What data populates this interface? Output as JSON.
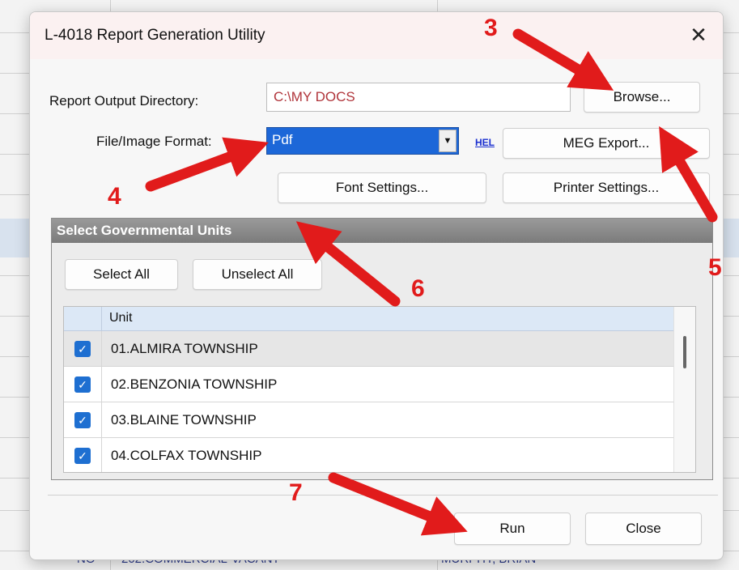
{
  "background": {
    "bottom_left_text": "NO",
    "bottom_mid_text": "202.COMMERCIAL-VACANT",
    "bottom_right_text": "MURPHY, BRIAN"
  },
  "dialog": {
    "title": "L-4018 Report Generation Utility",
    "close_glyph": "✕",
    "output_dir_label": "Report Output Directory:",
    "output_dir_value": "C:\\MY DOCS",
    "browse_label": "Browse...",
    "format_label": "File/Image Format:",
    "format_value": "Pdf",
    "format_arrow": "▼",
    "help_link": "HEL",
    "meg_export_label": "MEG Export...",
    "font_settings_label": "Font Settings...",
    "printer_settings_label": "Printer Settings...",
    "group": {
      "title": "Select Governmental Units",
      "select_all_label": "Select All",
      "unselect_all_label": "Unselect All",
      "column_header": "Unit",
      "rows": [
        {
          "label": "01.ALMIRA TOWNSHIP",
          "checked": true
        },
        {
          "label": "02.BENZONIA TOWNSHIP",
          "checked": true
        },
        {
          "label": "03.BLAINE TOWNSHIP",
          "checked": true
        },
        {
          "label": "04.COLFAX TOWNSHIP",
          "checked": true
        }
      ],
      "check_glyph": "✓"
    },
    "run_label": "Run",
    "close_label": "Close"
  },
  "annotations": {
    "color": "#e11b1b",
    "numbers": [
      "3",
      "4",
      "5",
      "6",
      "7"
    ]
  }
}
